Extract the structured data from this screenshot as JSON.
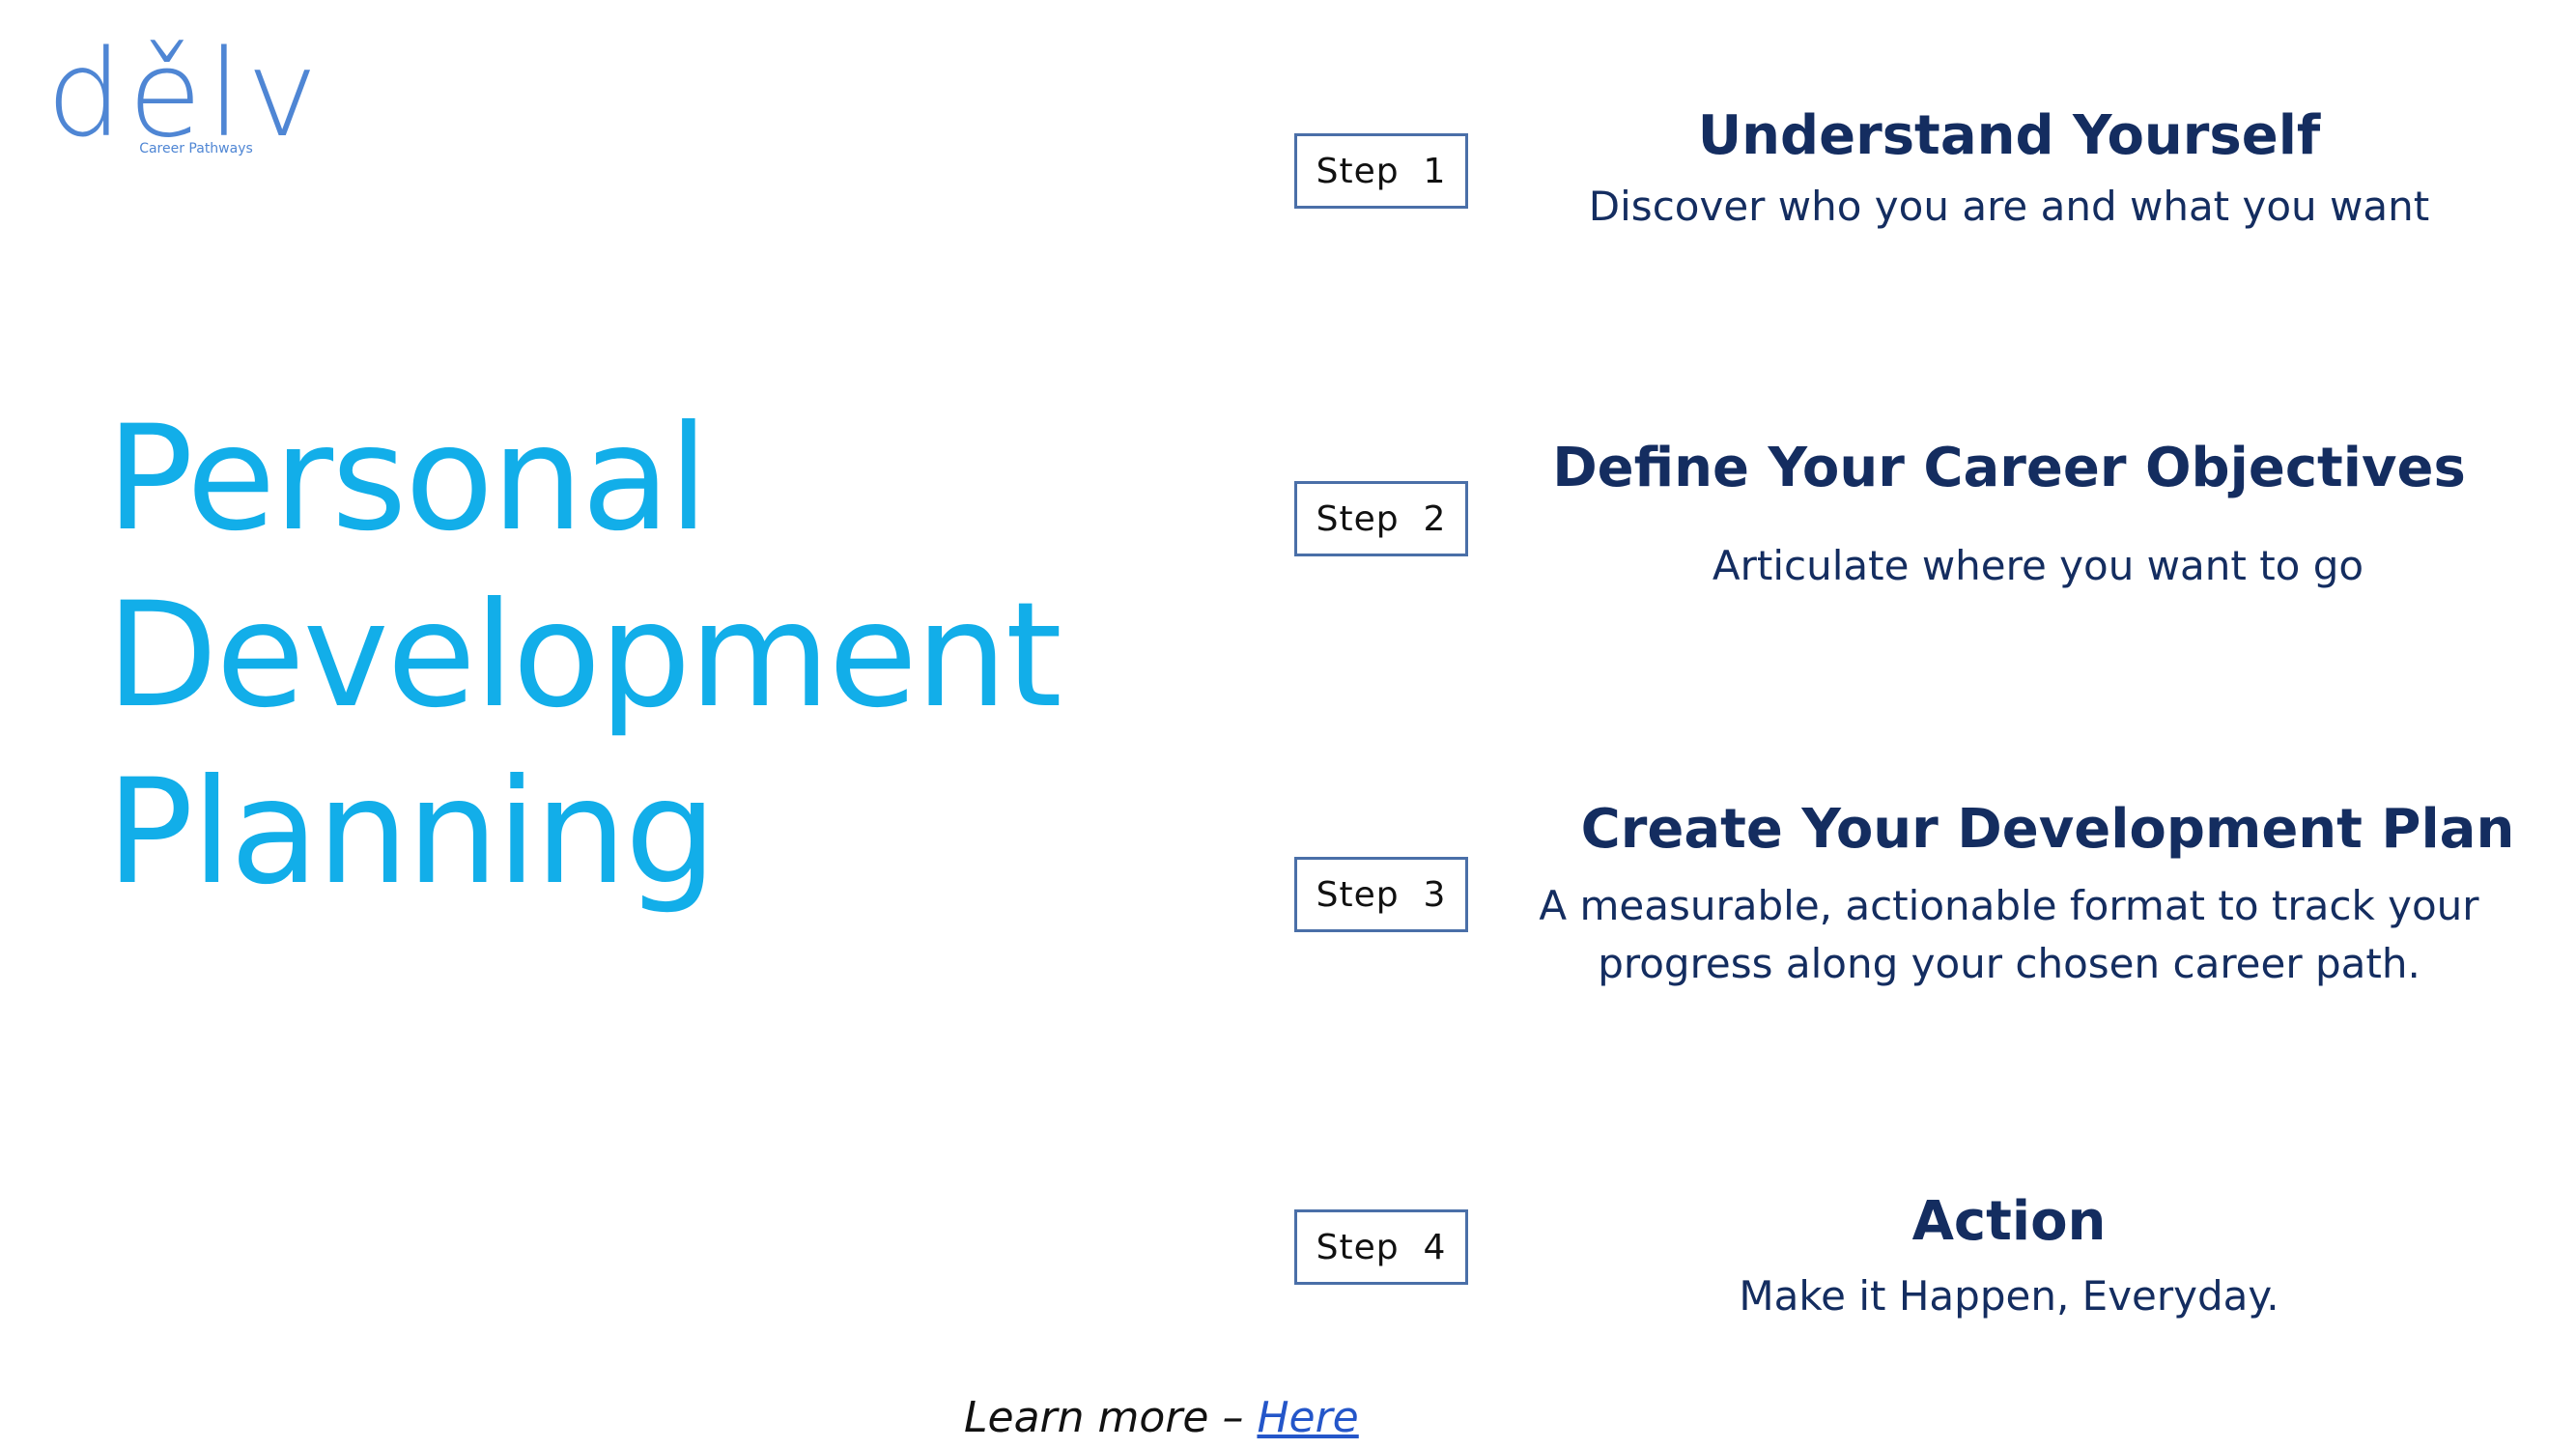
{
  "logo": {
    "word": "dělv",
    "tagline": "Career Pathways"
  },
  "title": {
    "line1": "Personal",
    "line2": "Development",
    "line3": "Planning"
  },
  "steps": [
    {
      "label": "Step  1",
      "heading": "Understand Yourself",
      "description": "Discover who you are and what you want"
    },
    {
      "label": "Step  2",
      "heading": "Define Your Career Objectives",
      "description": "Articulate where you want to go"
    },
    {
      "label": "Step  3",
      "heading": "Create Your Development Plan",
      "description": "A measurable, actionable format to track your progress along your chosen career path."
    },
    {
      "label": "Step  4",
      "heading": "Action",
      "description": "Make it Happen, Everyday."
    }
  ],
  "footer": {
    "prefix": "Learn more – ",
    "link_text": "Here"
  },
  "colors": {
    "title": "#12aee9",
    "heading": "#142d60",
    "logo": "#4f86d4",
    "link": "#2456c9",
    "box_border": "#4a6fa8"
  }
}
